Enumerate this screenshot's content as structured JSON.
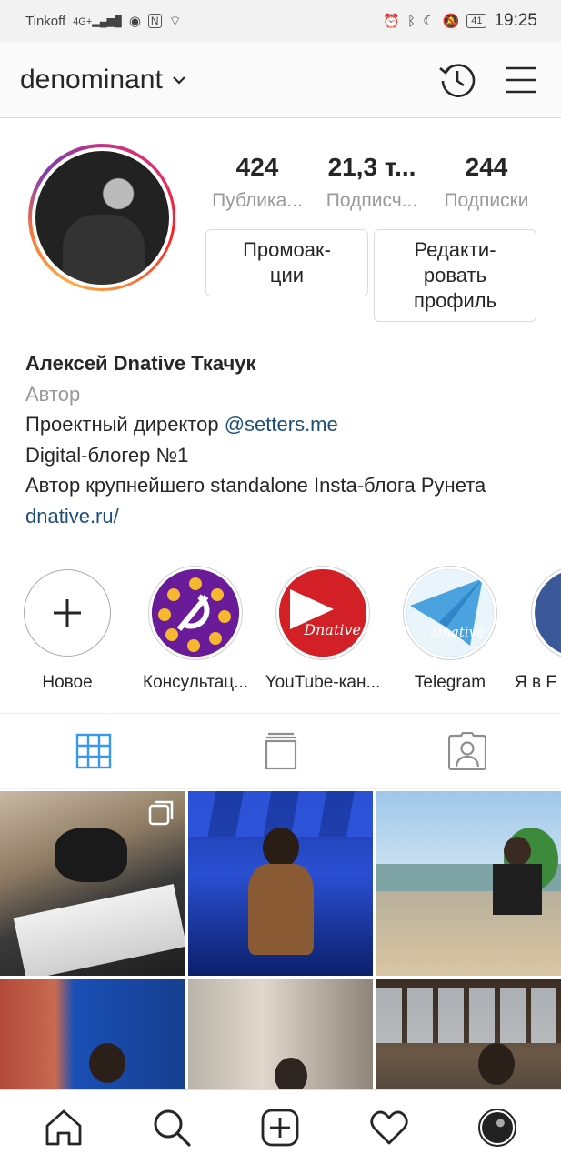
{
  "status_bar": {
    "carrier": "Tinkoff",
    "network": "4G+",
    "battery": "41",
    "time": "19:25"
  },
  "header": {
    "username": "denominant"
  },
  "profile": {
    "stats": [
      {
        "value": "424",
        "label": "Публика..."
      },
      {
        "value": "21,3 т...",
        "label": "Подписч..."
      },
      {
        "value": "244",
        "label": "Подписки"
      }
    ],
    "promo_button": "Промоак-\nции",
    "edit_button": "Редакти-\nровать\nпрофиль"
  },
  "bio": {
    "name": "Алексей Dnative Ткачук",
    "category": "Автор",
    "line1_prefix": "Проектный директор ",
    "line1_link": "@setters.me",
    "line2": "Digital-блогер №1",
    "line3": "Автор крупнейшего standalone Insta-блога Рунета",
    "website": "dnative.ru/"
  },
  "highlights": [
    {
      "label": "Новое",
      "icon": "plus-icon"
    },
    {
      "label": "Консультац...",
      "icon": "consult-cover"
    },
    {
      "label": "YouTube-кан...",
      "icon": "youtube-cover"
    },
    {
      "label": "Telegram",
      "icon": "telegram-cover"
    },
    {
      "label": "Я в F",
      "icon": "facebook-cover"
    }
  ],
  "highlight_cover_text": "Dnative",
  "tabs": [
    {
      "name": "grid",
      "active": true
    },
    {
      "name": "igtv",
      "active": false
    },
    {
      "name": "tagged",
      "active": false
    }
  ],
  "colors": {
    "link": "#1c4d7a",
    "active_tab": "#3897f0",
    "youtube_red": "#d32027",
    "consult_purple": "#6a1b9a",
    "telegram_blue": "#4aa3df"
  }
}
